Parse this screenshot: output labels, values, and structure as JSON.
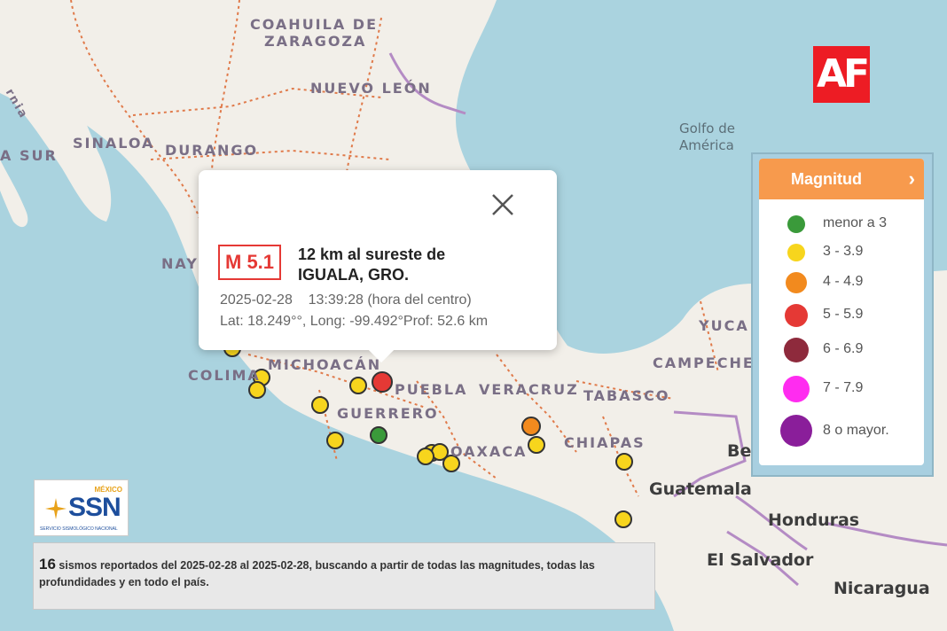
{
  "map": {
    "colors": {
      "water": "#aad3df",
      "land": "#f2efe9",
      "state_border": "#e07a4a",
      "country_border": "#b48bc4"
    },
    "state_labels": [
      "COAHUILA DE",
      "ZARAGOZA",
      "NUEVO LEÓN",
      "SINALOA",
      "DURANGO",
      "NAY",
      "MICHOACÁN",
      "COLIMA",
      "GUERRERO",
      "PUEBLA",
      "VERACRUZ",
      "TABASCO",
      "OAXACA",
      "CHIAPAS",
      "YUCA",
      "CAMPECHE"
    ],
    "region_labels_partial": [
      "A SUR",
      "rnia"
    ],
    "sea_label": "Golfo de América",
    "country_labels": [
      "Guatemala",
      "Honduras",
      "El Salvador",
      "Nicaragua",
      "Be"
    ]
  },
  "popup": {
    "magnitude": "M 5.1",
    "place_line1": "12 km al sureste de",
    "place_line2": "IGUALA, GRO.",
    "datetime": "2025-02-28    13:39:28 (hora del centro)",
    "coords": "Lat: 18.249°°, Long: -99.492°Prof: 52.6 km",
    "close_icon": "close-icon"
  },
  "brand": {
    "logo_text": "AF",
    "color": "#ed1c24"
  },
  "legend": {
    "title": "Magnitud",
    "chevron": "›",
    "items": [
      {
        "label": "menor a 3",
        "color": "#3a9a3a"
      },
      {
        "label": "3 - 3.9",
        "color": "#f7d51d"
      },
      {
        "label": "4 - 4.9",
        "color": "#f28a1e"
      },
      {
        "label": "5 - 5.9",
        "color": "#e53935"
      },
      {
        "label": "6 - 6.9",
        "color": "#8e2a3c"
      },
      {
        "label": "7 - 7.9",
        "color": "#ff2cf0"
      },
      {
        "label": "8 o mayor.",
        "color": "#8a1e9a"
      }
    ]
  },
  "ssn": {
    "country": "MÉXICO",
    "name": "SSN",
    "subtitle": "SERVICIO SISMOLÓGICO NACIONAL"
  },
  "summary": {
    "count": "16",
    "text": " sismos reportados del 2025-02-28 al 2025-02-28, buscando a partir de todas las magnitudes, todas las profundidades y en todo el país."
  },
  "quakes": [
    {
      "magnitude_class": "5 - 5.9",
      "selected": true
    },
    {
      "magnitude_class": "3 - 3.9"
    },
    {
      "magnitude_class": "3 - 3.9"
    },
    {
      "magnitude_class": "3 - 3.9"
    },
    {
      "magnitude_class": "3 - 3.9"
    },
    {
      "magnitude_class": "3 - 3.9"
    },
    {
      "magnitude_class": "3 - 3.9"
    },
    {
      "magnitude_class": "menor a 3"
    },
    {
      "magnitude_class": "3 - 3.9"
    },
    {
      "magnitude_class": "3 - 3.9"
    },
    {
      "magnitude_class": "3 - 3.9"
    },
    {
      "magnitude_class": "3 - 3.9"
    },
    {
      "magnitude_class": "4 - 4.9"
    },
    {
      "magnitude_class": "3 - 3.9"
    },
    {
      "magnitude_class": "3 - 3.9"
    },
    {
      "magnitude_class": "3 - 3.9"
    }
  ]
}
